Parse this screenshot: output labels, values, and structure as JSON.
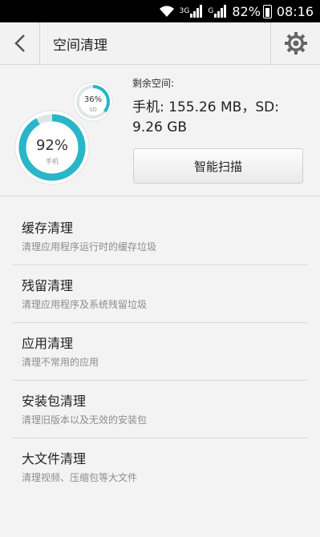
{
  "status_bar": {
    "net1": "3G",
    "net2": "G",
    "battery": "82%",
    "time": "08:16"
  },
  "header": {
    "title": "空间清理"
  },
  "storage": {
    "phone_percent": "92%",
    "phone_label": "手机",
    "phone_used_fraction": 0.92,
    "sd_percent": "36%",
    "sd_label": "SD",
    "sd_used_fraction": 0.36,
    "free_label": "剩余空间:",
    "free_value": "手机: 155.26 MB，SD: 9.26 GB",
    "scan_label": "智能扫描"
  },
  "colors": {
    "accent": "#29b6c8",
    "ring_track": "#dfe6e8"
  },
  "items": [
    {
      "title": "缓存清理",
      "subtitle": "清理应用程序运行时的缓存垃圾"
    },
    {
      "title": "残留清理",
      "subtitle": "清理应用程序及系统残留垃圾"
    },
    {
      "title": "应用清理",
      "subtitle": "清理不常用的应用"
    },
    {
      "title": "安装包清理",
      "subtitle": "清理旧版本以及无效的安装包"
    },
    {
      "title": "大文件清理",
      "subtitle": "清理视频、压缩包等大文件"
    }
  ]
}
